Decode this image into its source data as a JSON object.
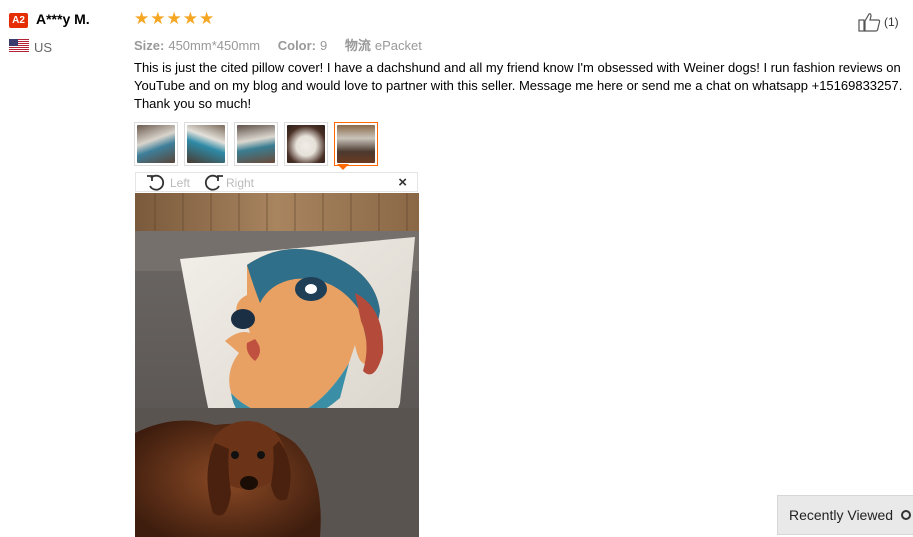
{
  "reviewer": {
    "badge": "A2",
    "name": "A***y M.",
    "country": "US"
  },
  "rating": {
    "stars": 5,
    "max": 5
  },
  "meta": {
    "size_label": "Size:",
    "size_value": "450mm*450mm",
    "color_label": "Color:",
    "color_value": "9",
    "shipping_label": "物流",
    "shipping_value": "ePacket"
  },
  "review": {
    "text": "This is just the cited pillow cover! I have a dachshund and all my friend know I'm obsessed with Weiner dogs! I run fashion reviews on YouTube and on my blog and would love to partner with this seller. Message me here or send me a chat on whatsapp +15169833257. Thank you so much!"
  },
  "helpful": {
    "count": "(1)",
    "icon": "thumbs-up-icon"
  },
  "viewer": {
    "rotate_left_label": "Left",
    "rotate_right_label": "Right",
    "close_label": "×"
  },
  "thumbnails": {
    "count": 5,
    "active_index": 4
  },
  "recently_viewed": {
    "label": "Recently Viewed"
  },
  "colors": {
    "accent": "#ff6a00",
    "star": "#f5a623",
    "badge": "#e62e04"
  }
}
